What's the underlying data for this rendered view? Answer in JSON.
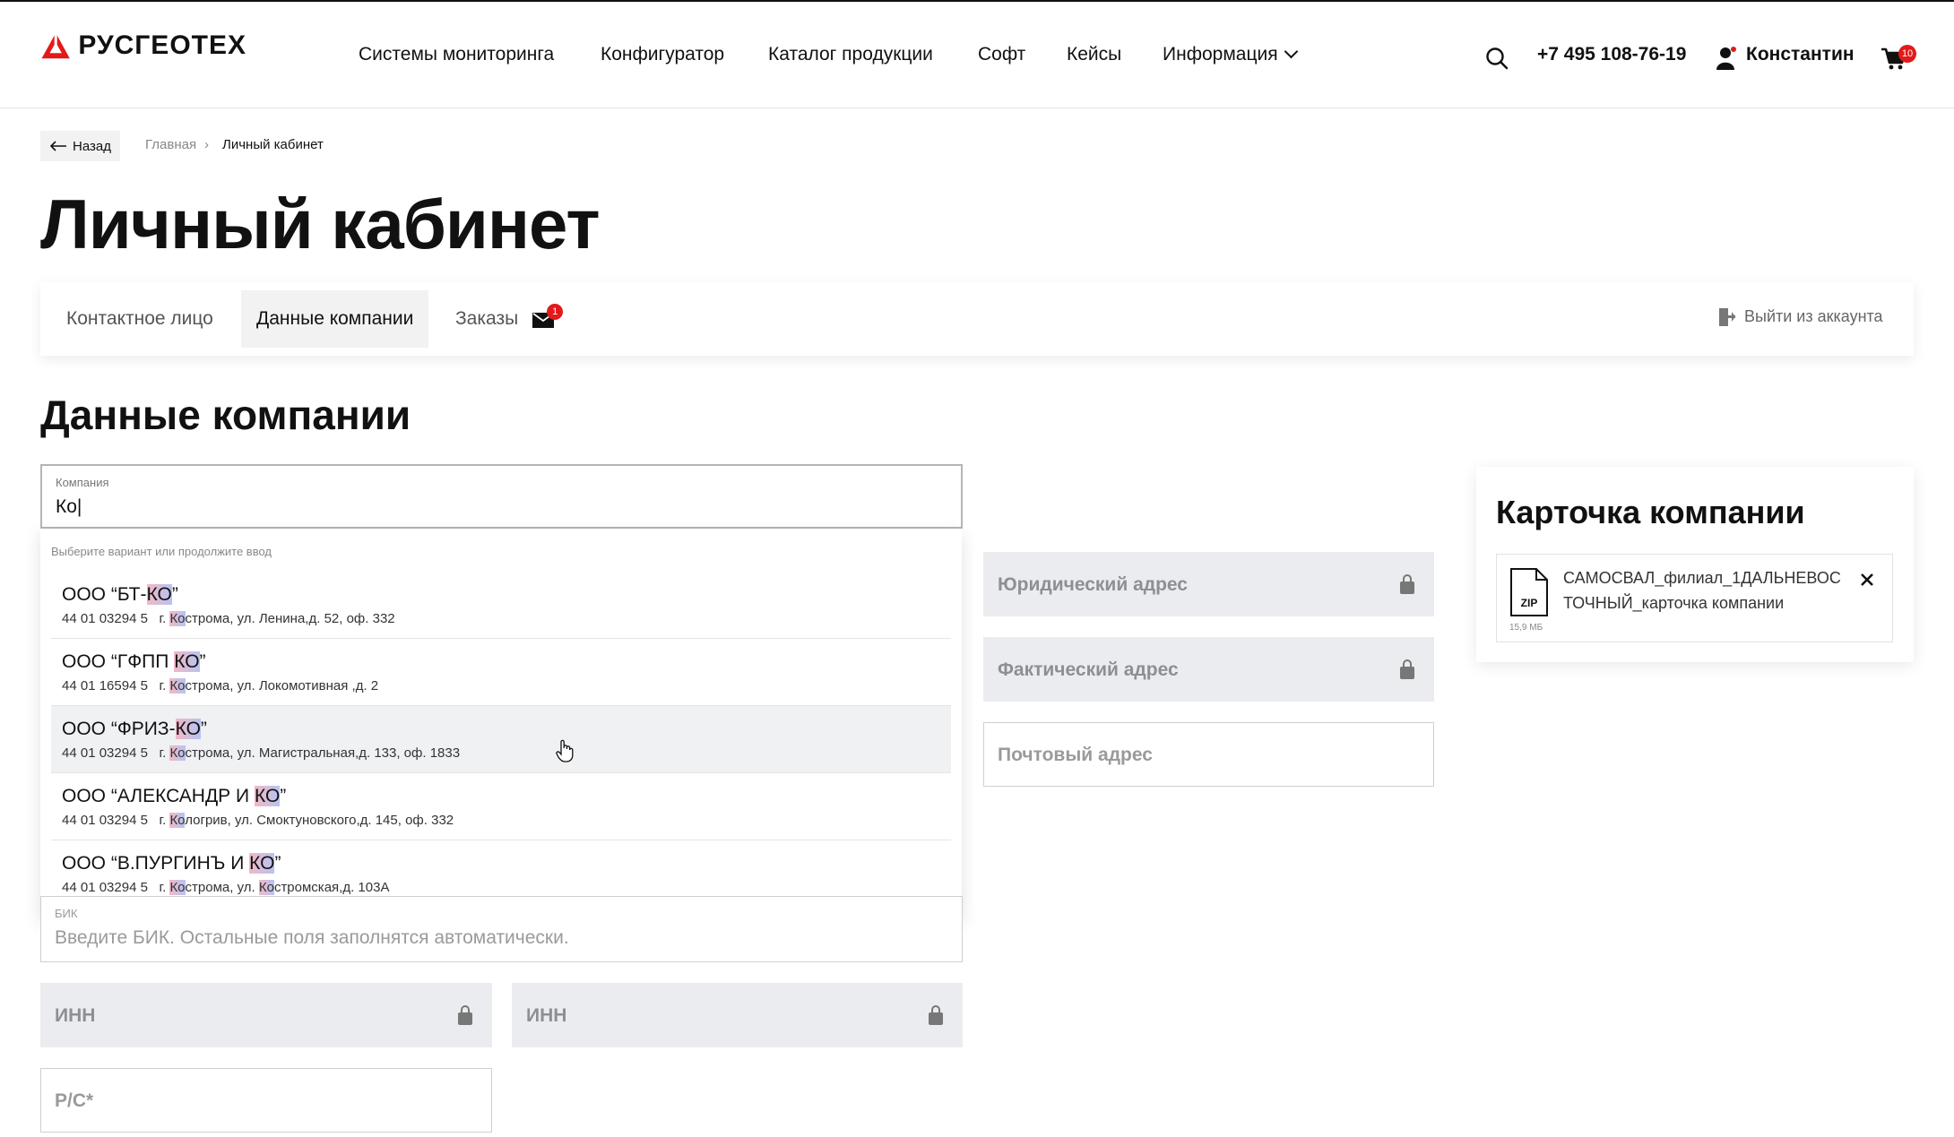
{
  "header": {
    "logo_text": "РУСГЕОТЕХ",
    "nav": [
      "Системы мониторинга",
      "Конфигуратор",
      "Каталог продукции",
      "Софт",
      "Кейсы",
      "Информация"
    ],
    "phone": "+7 495 108-76-19",
    "user_name": "Константин",
    "cart_count": "10"
  },
  "breadcrumb": {
    "back_label": "Назад",
    "home": "Главная",
    "current": "Личный кабинет"
  },
  "page_title": "Личный кабинет",
  "tabs": {
    "items": [
      "Контактное лицо",
      "Данные компании",
      "Заказы"
    ],
    "orders_badge": "1",
    "logout": "Выйти из аккаунта"
  },
  "section_title": "Данные компании",
  "company_input": {
    "label": "Компания",
    "value": "Ко|"
  },
  "dropdown": {
    "hint": "Выберите вариант или продолжите ввод",
    "items": [
      {
        "name_pre": "ООО “БТ-",
        "name_hl": "КО",
        "name_post": "”",
        "code": "44 01 03294 5",
        "addr_pre": "г. ",
        "addr_hl": "Ко",
        "addr_post": "строма, ул. Ленина,д. 52, оф. 332"
      },
      {
        "name_pre": "ООО “ГФПП ",
        "name_hl": "КО",
        "name_post": "”",
        "code": "44 01 16594 5",
        "addr_pre": "г. ",
        "addr_hl": "Ко",
        "addr_post": "строма, ул. Локомотивная ,д. 2"
      },
      {
        "name_pre": "ООО “ФРИЗ-",
        "name_hl": "КО",
        "name_post": "”",
        "code": "44 01 03294 5",
        "addr_pre": "г. ",
        "addr_hl": "Ко",
        "addr_post": "строма, ул. Магистральная,д. 133, оф. 1833"
      },
      {
        "name_pre": "ООО “АЛЕКСАНДР И ",
        "name_hl": "КО",
        "name_post": "”",
        "code": "44 01 03294 5",
        "addr_pre": "г. ",
        "addr_hl": "Ко",
        "addr_post": "логрив, ул. Смоктуновского,д. 145, оф. 332"
      },
      {
        "name_pre": "ООО “В.ПУРГИНЪ И ",
        "name_hl": "КО",
        "name_post": "”",
        "code": "44 01 03294 5",
        "addr_pre": "г. ",
        "addr_hl": "Ко",
        "addr_post": "строма, ул. ",
        "addr_hl2": "Ко",
        "addr_post2": "стромская,д. 103А"
      }
    ]
  },
  "fields": {
    "legal_address": "Юридический адрес",
    "actual_address": "Фактический адрес",
    "postal_address": "Почтовый адрес",
    "bik_label": "БИК",
    "bik_placeholder": "Введите БИК. Остальные поля заполнятся автоматически.",
    "inn_1": "ИНН",
    "inn_2": "ИНН",
    "rs": "Р/С*"
  },
  "company_card": {
    "title": "Карточка компании",
    "file_type": "ZIP",
    "file_name_line1": "САМОСВАЛ_филиал_1ДАЛЬНЕВОС",
    "file_name_line2": "ТОЧНЫЙ_карточка компании",
    "file_size": "15,9 МБ"
  },
  "colors": {
    "brand_red": "#e21a1a",
    "locked_bg": "#ebecef",
    "hover_bg": "#f0f1f3"
  }
}
